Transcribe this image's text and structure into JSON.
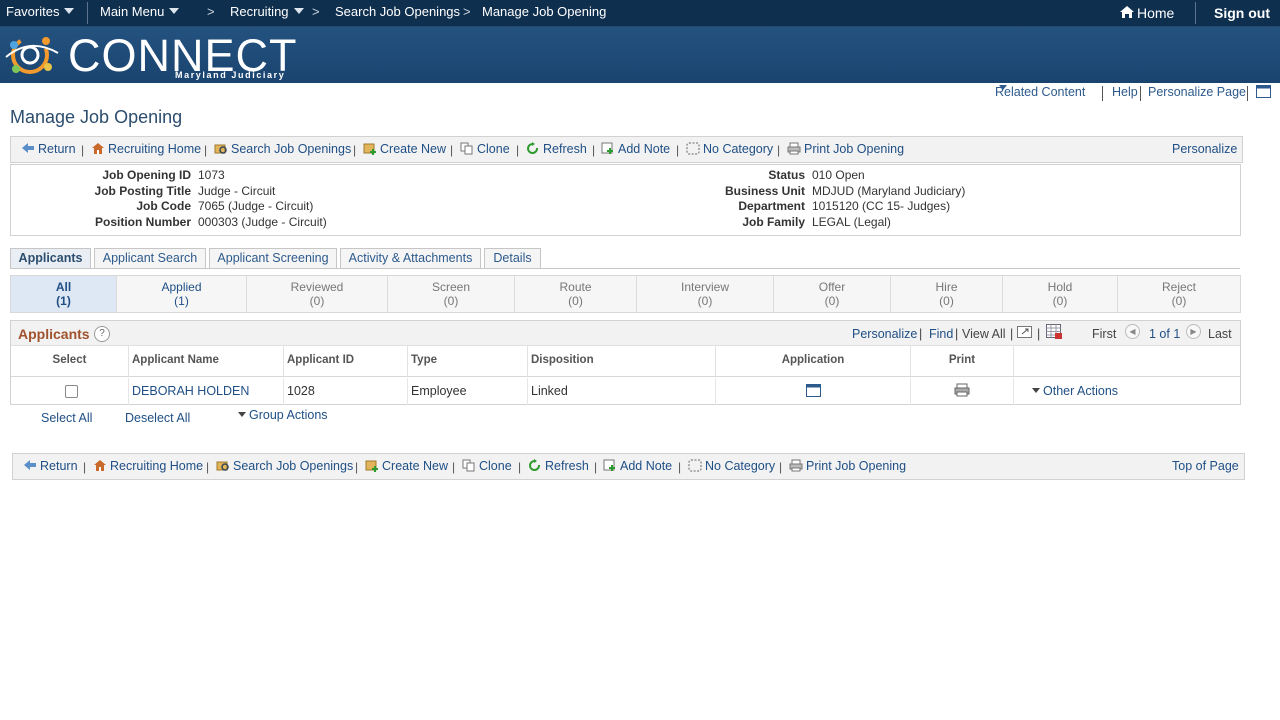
{
  "topbar": {
    "favorites": "Favorites",
    "main_menu": "Main Menu",
    "breadcrumb": [
      "Recruiting",
      "Search Job Openings",
      "Manage Job Opening"
    ],
    "home": "Home",
    "sign_out": "Sign out"
  },
  "banner": {
    "logo_text": "CONNECT",
    "logo_sub": "Maryland Judiciary"
  },
  "pagelinks": {
    "related": "Related Content",
    "help": "Help",
    "personalize": "Personalize Page"
  },
  "page_title": "Manage Job Opening",
  "toolbar": {
    "items": [
      "Return",
      "Recruiting Home",
      "Search Job Openings",
      "Create New",
      "Clone",
      "Refresh",
      "Add Note",
      "No Category",
      "Print Job Opening"
    ],
    "personalize": "Personalize",
    "top_of_page": "Top of Page"
  },
  "info": {
    "left": [
      {
        "label": "Job Opening ID",
        "value": "1073"
      },
      {
        "label": "Job Posting Title",
        "value": "Judge - Circuit"
      },
      {
        "label": "Job Code",
        "value": "7065 (Judge - Circuit)"
      },
      {
        "label": "Position Number",
        "value": "000303 (Judge - Circuit)"
      }
    ],
    "right": [
      {
        "label": "Status",
        "value": "010 Open"
      },
      {
        "label": "Business Unit",
        "value": "MDJUD (Maryland Judiciary)"
      },
      {
        "label": "Department",
        "value": "1015120 (CC 15- Judges)"
      },
      {
        "label": "Job Family",
        "value": "LEGAL (Legal)"
      }
    ]
  },
  "tabs": [
    "Applicants",
    "Applicant Search",
    "Applicant Screening",
    "Activity & Attachments",
    "Details"
  ],
  "statuses": [
    {
      "name": "All",
      "count": "(1)"
    },
    {
      "name": "Applied",
      "count": "(1)"
    },
    {
      "name": "Reviewed",
      "count": "(0)"
    },
    {
      "name": "Screen",
      "count": "(0)"
    },
    {
      "name": "Route",
      "count": "(0)"
    },
    {
      "name": "Interview",
      "count": "(0)"
    },
    {
      "name": "Offer",
      "count": "(0)"
    },
    {
      "name": "Hire",
      "count": "(0)"
    },
    {
      "name": "Hold",
      "count": "(0)"
    },
    {
      "name": "Reject",
      "count": "(0)"
    }
  ],
  "grid": {
    "title": "Applicants",
    "help": "?",
    "personalize": "Personalize",
    "find": "Find",
    "view_all": "View All",
    "first": "First",
    "pager": "1 of 1",
    "last": "Last",
    "columns": [
      "Select",
      "Applicant Name",
      "Applicant ID",
      "Type",
      "Disposition",
      "Application",
      "Print"
    ],
    "rows": [
      {
        "name": "DEBORAH HOLDEN",
        "id": "1028",
        "type": "Employee",
        "disposition": "Linked",
        "other_actions": "Other Actions"
      }
    ]
  },
  "below": {
    "select_all": "Select All",
    "deselect_all": "Deselect All",
    "group_actions": "Group Actions"
  }
}
